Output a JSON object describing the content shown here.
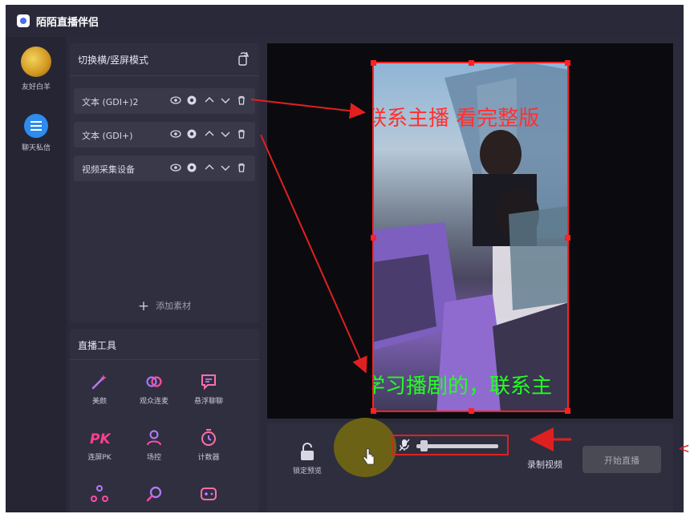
{
  "app": {
    "title": "陌陌直播伴侣"
  },
  "sidebar": {
    "items": [
      {
        "label": "友好白羊",
        "icon": "avatar"
      },
      {
        "label": "聊天私信",
        "icon": "chat-icon"
      }
    ]
  },
  "scene_panel": {
    "title": "切换横/竖屏模式",
    "sources": [
      {
        "name": "文本 (GDI+)2"
      },
      {
        "name": "文本 (GDI+)"
      },
      {
        "name": "视频采集设备"
      }
    ],
    "add_label": "添加素材"
  },
  "tools_panel": {
    "title": "直播工具",
    "tools": [
      {
        "label": "美颜",
        "icon": "magic-wand-icon"
      },
      {
        "label": "观众连麦",
        "icon": "link-icon"
      },
      {
        "label": "悬浮聊聊",
        "icon": "chat-bubble-icon"
      },
      {
        "label": "连屏PK",
        "icon": "pk-icon"
      },
      {
        "label": "场控",
        "icon": "user-icon"
      },
      {
        "label": "计数器",
        "icon": "timer-icon"
      },
      {
        "label": "",
        "icon": "share-icon"
      },
      {
        "label": "",
        "icon": "search-icon"
      },
      {
        "label": "",
        "icon": "gamepad-icon"
      }
    ]
  },
  "preview": {
    "overlay_top": "联系主播 看完整版",
    "overlay_bottom": "学习播剧的，联系主"
  },
  "bottom": {
    "lock_label": "锁定预览",
    "record_label": "录制视频",
    "start_label": "开始直播",
    "volume_level": 0.05
  },
  "colors": {
    "annotation_red": "#e02020",
    "accent_pink": "#ff4da6",
    "accent_purple": "#8c7bff"
  }
}
